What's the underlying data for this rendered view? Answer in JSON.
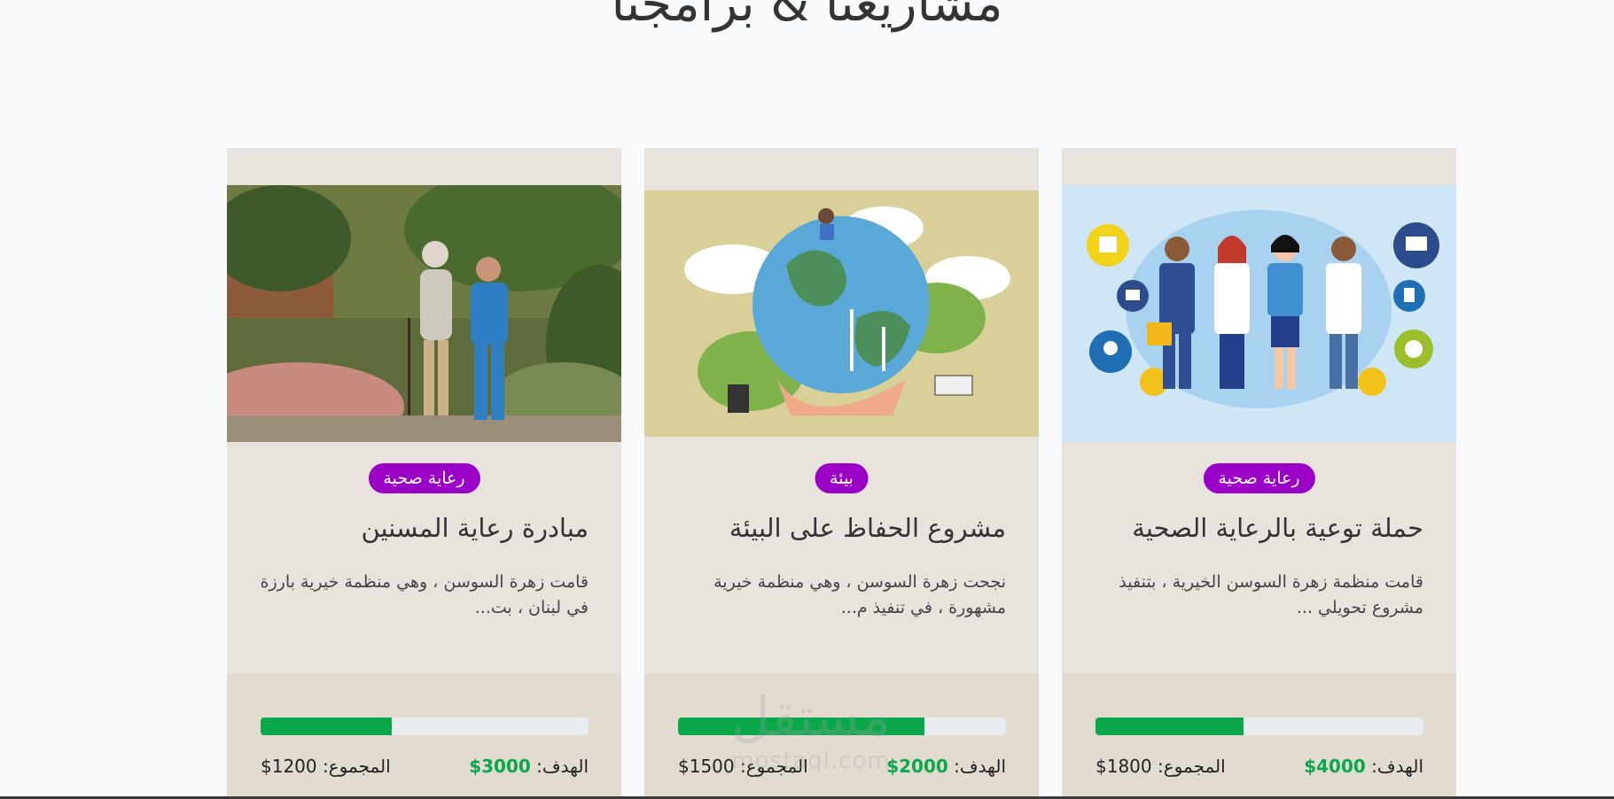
{
  "section": {
    "title": "مشاريعنا & برامجنا"
  },
  "projects": [
    {
      "badge": "رعاية صحية",
      "title": "حملة توعية بالرعاية الصحية",
      "description": "قامت منظمة زهرة السوسن الخيرية ، بتنفيذ مشروع تحويلي ...",
      "progress": 0.45,
      "goal_label": "الهدف:",
      "goal_value": "4000$",
      "total_label": "المجموع:",
      "total_value": "1800$",
      "image": "healthcare-team-illustration"
    },
    {
      "badge": "بيئة",
      "title": "مشروع الحفاظ على البيئة",
      "description": "نجحت زهرة السوسن ، وهي منظمة خيرية مشهورة ، في تنفيذ م...",
      "progress": 0.75,
      "goal_label": "الهدف:",
      "goal_value": "2000$",
      "total_label": "المجموع:",
      "total_value": "1500$",
      "image": "earth-in-hands-illustration"
    },
    {
      "badge": "رعاية صحية",
      "title": "مبادرة رعاية المسنين",
      "description": "قامت زهرة السوسن ، وهي منظمة خيرية بارزة في لبنان ، بت...",
      "progress": 0.4,
      "goal_label": "الهدف:",
      "goal_value": "3000$",
      "total_label": "المجموع:",
      "total_value": "1200$",
      "image": "elderly-care-photo"
    }
  ],
  "watermark": {
    "text": "مستقل",
    "subtext": "mostaql.com"
  },
  "colors": {
    "badge": "#9b00c6",
    "progress": "#0aa84a",
    "card": "#e8e3dc",
    "card_footer": "#e2dbcf"
  }
}
